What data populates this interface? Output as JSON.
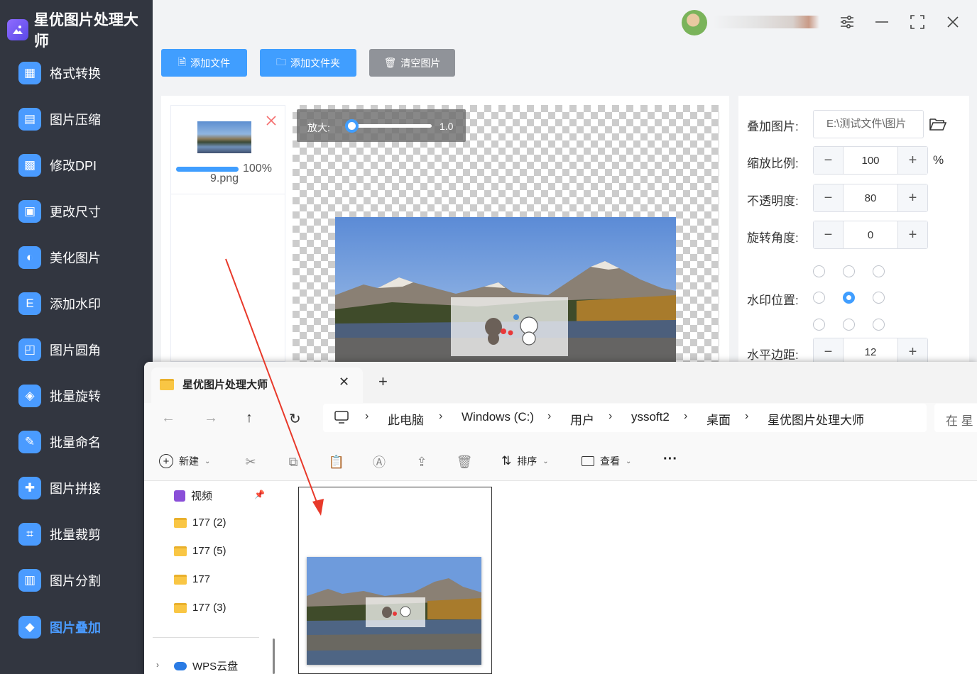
{
  "app": {
    "title": "星优图片处理大师",
    "user_name": "y..."
  },
  "sidebar": {
    "items": [
      {
        "label": "格式转换",
        "icon": "format-convert-icon",
        "color": "#4a9bff"
      },
      {
        "label": "图片压缩",
        "icon": "compress-icon",
        "color": "#4a9bff"
      },
      {
        "label": "修改DPI",
        "icon": "dpi-icon",
        "color": "#4a9bff"
      },
      {
        "label": "更改尺寸",
        "icon": "resize-icon",
        "color": "#4a9bff"
      },
      {
        "label": "美化图片",
        "icon": "beautify-icon",
        "color": "#4a9bff"
      },
      {
        "label": "添加水印",
        "icon": "watermark-icon",
        "color": "#4a9bff"
      },
      {
        "label": "图片圆角",
        "icon": "round-corner-icon",
        "color": "#4a9bff"
      },
      {
        "label": "批量旋转",
        "icon": "rotate-icon",
        "color": "#4a9bff"
      },
      {
        "label": "批量命名",
        "icon": "rename-icon",
        "color": "#4a9bff"
      },
      {
        "label": "图片拼接",
        "icon": "splice-icon",
        "color": "#4a9bff"
      },
      {
        "label": "批量裁剪",
        "icon": "crop-icon",
        "color": "#4a9bff"
      },
      {
        "label": "图片分割",
        "icon": "split-icon",
        "color": "#4a9bff"
      },
      {
        "label": "图片叠加",
        "icon": "overlay-icon",
        "color": "#4a9bff"
      }
    ],
    "active_index": 12
  },
  "toolbar": {
    "add_file": "添加文件",
    "add_folder": "添加文件夹",
    "clear": "清空图片"
  },
  "file_list": {
    "items": [
      {
        "name": "9.png",
        "progress_label": "100%",
        "progress": 1.0
      }
    ]
  },
  "preview": {
    "zoom_label": "放大:",
    "zoom_value": "1.0"
  },
  "settings": {
    "overlay_image": {
      "label": "叠加图片:",
      "value": "E:\\测试文件\\图片"
    },
    "scale": {
      "label": "缩放比例:",
      "value": "100",
      "unit": "%"
    },
    "opacity": {
      "label": "不透明度:",
      "value": "80"
    },
    "rotation": {
      "label": "旋转角度:",
      "value": "0"
    },
    "position": {
      "label": "水印位置:",
      "selected": "center"
    },
    "h_margin": {
      "label": "水平边距:",
      "value": "12"
    }
  },
  "explorer": {
    "tab_title": "星优图片处理大师",
    "breadcrumb": [
      "此电脑",
      "Windows (C:)",
      "用户",
      "yssoft2",
      "桌面",
      "星优图片处理大师"
    ],
    "search_placeholder": "在 星",
    "cmd": {
      "new": "新建",
      "sort": "排序",
      "view": "查看",
      "more": "···"
    },
    "nav": [
      {
        "label": "视频",
        "type": "video"
      },
      {
        "label": "177 (2)",
        "type": "folder"
      },
      {
        "label": "177 (5)",
        "type": "folder"
      },
      {
        "label": "177",
        "type": "folder"
      },
      {
        "label": "177 (3)",
        "type": "folder"
      },
      {
        "label": "WPS云盘",
        "type": "cloud"
      }
    ]
  },
  "colors": {
    "accent": "#409eff",
    "sidebar_bg": "#323640",
    "clear_btn": "#909399",
    "delete_x": "#f56c6c",
    "arrow": "#e8392a"
  }
}
